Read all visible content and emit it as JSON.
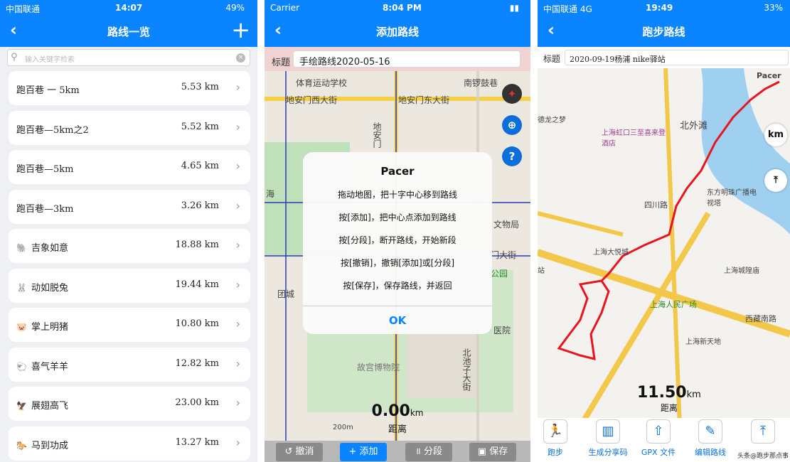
{
  "screen1": {
    "status": {
      "carrier": "中国联通",
      "time": "14:07",
      "battery": "49%"
    },
    "title": "路线一览",
    "search_placeholder": "输入关键字检索",
    "routes": [
      {
        "icon": "",
        "name": "跑百巷 一 5km",
        "distance": "5.53 km"
      },
      {
        "icon": "",
        "name": "跑百巷—5km之2",
        "distance": "5.52 km"
      },
      {
        "icon": "",
        "name": "跑百巷—5km",
        "distance": "4.65 km"
      },
      {
        "icon": "",
        "name": "跑百巷—3km",
        "distance": "3.26 km"
      },
      {
        "icon": "🐘",
        "name": "吉象如意",
        "distance": "18.88 km"
      },
      {
        "icon": "🐰",
        "name": "动如脱兔",
        "distance": "19.44 km"
      },
      {
        "icon": "🐷",
        "name": "掌上明猪",
        "distance": "10.80 km"
      },
      {
        "icon": "🐑",
        "name": "喜气羊羊",
        "distance": "12.82 km"
      },
      {
        "icon": "🦅",
        "name": "展翅高飞",
        "distance": "23.00 km"
      },
      {
        "icon": "🐎",
        "name": "马到功成",
        "distance": "13.27 km"
      }
    ]
  },
  "screen2": {
    "status": {
      "carrier": "Carrier",
      "time": "8:04 PM"
    },
    "title": "添加路线",
    "title_label": "标题",
    "title_value": "手绘路线2020-05-16",
    "map_labels": {
      "school": "体育运动学校",
      "drum": "南锣鼓巷",
      "west_street": "地安门西大街",
      "east_street": "地安门东大街",
      "anmen": "地安门",
      "hai": "海",
      "museum_short": "文物局",
      "east_street2": "门大街",
      "park": "公园",
      "tuancheng": "团城",
      "hospital": "医院",
      "palace": "故宫博物院",
      "beichizi": "北池子大街",
      "scale": "200m"
    },
    "dialog": {
      "title": "Pacer",
      "lines": [
        "拖动地图，把十字中心移到路线",
        "按[添加]，把中心点添加到路线",
        "按[分段]，断开路线，开始新段",
        "按[撤销]，撤销[添加]或[分段]",
        "按[保存]，保存路线，并返回"
      ],
      "ok": "OK"
    },
    "distance": {
      "value": "0.00",
      "unit": "km",
      "label": "距离"
    },
    "buttons": {
      "undo": "撤消",
      "add": "添加",
      "split": "分段",
      "save": "保存"
    }
  },
  "screen3": {
    "status": {
      "carrier": "中国联通 4G",
      "time": "19:49",
      "battery": "33%"
    },
    "title": "跑步路线",
    "title_label": "标题",
    "title_value": "2020-09-19杨浦 nike驿站",
    "map_labels": {
      "pacer": "Pacer",
      "north_bund": "北外滩",
      "hongkou": "上海虹口三至喜来登酒店",
      "sichuan": "四川路",
      "tower": "东方明珠广播电视塔",
      "grand": "上海大悦城",
      "peoples": "上海人民广场",
      "temple": "上海城隍庙",
      "xintiandi": "上海新天地",
      "xizang": "西藏南路",
      "dragon": "德龙之梦",
      "station": "站"
    },
    "side_km": "km",
    "distance": {
      "value": "11.50",
      "unit": "km",
      "label": "距离"
    },
    "toolbar": [
      {
        "icon": "running-icon",
        "glyph": "🏃",
        "label": "跑步"
      },
      {
        "icon": "share-icon",
        "glyph": "▥",
        "label": "生成分享码"
      },
      {
        "icon": "export-icon",
        "glyph": "⇧",
        "label": "GPX 文件"
      },
      {
        "icon": "edit-icon",
        "glyph": "✎",
        "label": "编辑路线"
      },
      {
        "icon": "signpost-icon",
        "glyph": "⤒",
        "label": ""
      }
    ],
    "watermark": "头条@跑步那点事"
  },
  "colors": {
    "accent": "#0a84ff",
    "route": "#e8141e"
  }
}
